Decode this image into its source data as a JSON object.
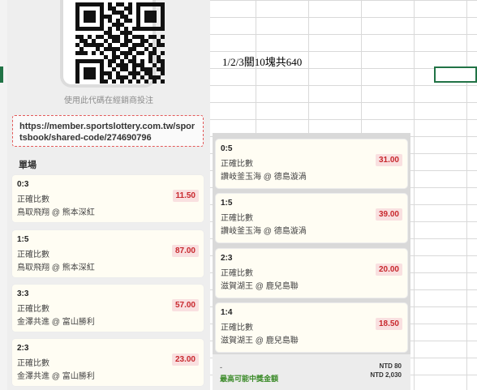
{
  "spreadsheet": {
    "cell_text": "1/2/3關10塊共640"
  },
  "qr": {
    "caption": "使用此代碼在經銷商投注"
  },
  "share_link": "https://member.sportslottery.com.tw/sportsbook/shared-code/274690796",
  "left_section_title": "單場",
  "left_bets": [
    {
      "score": "0:3",
      "type": "正確比數",
      "match": "鳥取飛翔 @ 熊本深紅",
      "odds": "11.50"
    },
    {
      "score": "1:5",
      "type": "正確比數",
      "match": "鳥取飛翔 @ 熊本深紅",
      "odds": "87.00"
    },
    {
      "score": "3:3",
      "type": "正確比數",
      "match": "金澤共進 @ 富山勝利",
      "odds": "57.00"
    },
    {
      "score": "2:3",
      "type": "正確比數",
      "match": "金澤共進 @ 富山勝利",
      "odds": "23.00"
    }
  ],
  "right_bets": [
    {
      "score": "0:5",
      "type": "正確比數",
      "match": "讚岐釜玉海 @ 德島漩渦",
      "odds": "31.00"
    },
    {
      "score": "1:5",
      "type": "正確比數",
      "match": "讚岐釜玉海 @ 德島漩渦",
      "odds": "39.00"
    },
    {
      "score": "2:3",
      "type": "正確比數",
      "match": "滋賀湖王 @ 鹿兒島聯",
      "odds": "20.00"
    },
    {
      "score": "1:4",
      "type": "正確比數",
      "match": "滋賀湖王 @ 鹿兒島聯",
      "odds": "18.50"
    }
  ],
  "summary": {
    "dash": "-",
    "max_win_label": "最高可能中獎金額",
    "stake": "NTD 80",
    "max_payout": "NTD 2,030"
  },
  "colors": {
    "odds_red": "#c8282d",
    "win_green": "#3a8a28",
    "excel_green": "#217346"
  }
}
